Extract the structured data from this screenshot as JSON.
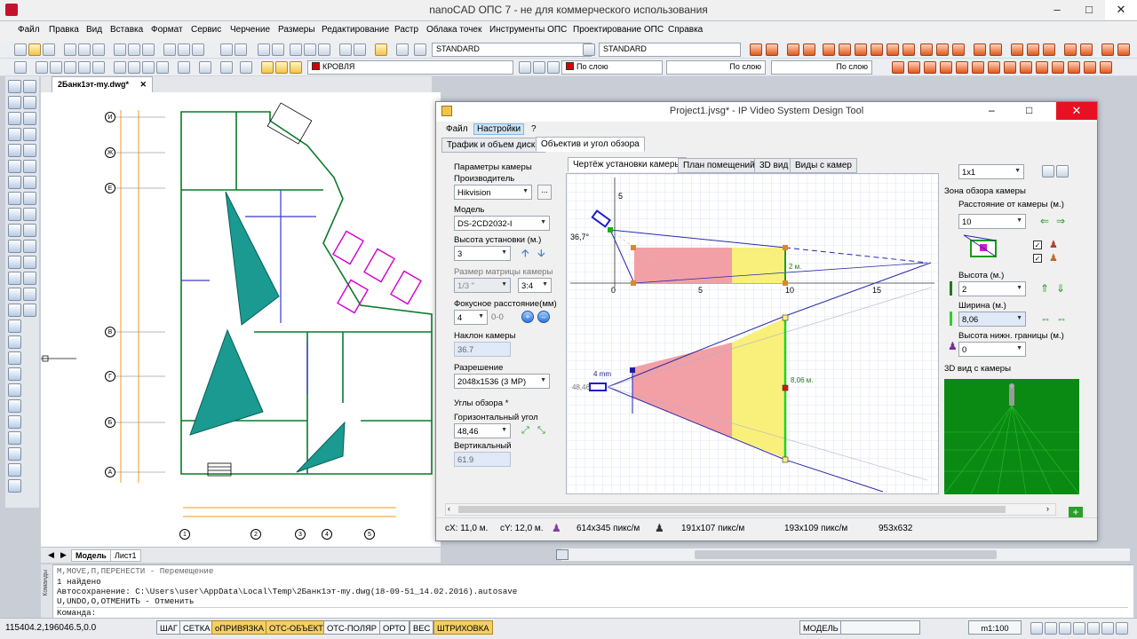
{
  "app": {
    "title": "nanoCAD ОПС 7 - не для коммерческого использования"
  },
  "menu": [
    "Файл",
    "Правка",
    "Вид",
    "Вставка",
    "Формат",
    "Сервис",
    "Черчение",
    "Размеры",
    "Редактирование",
    "Растр",
    "Облака точек",
    "Инструменты ОПС",
    "Проектирование ОПС",
    "Справка"
  ],
  "toolbar": {
    "text_style": "STANDARD",
    "dim_style": "STANDARD",
    "layer": "КРОВЛЯ",
    "color": "По слою",
    "linetype": "По слою",
    "lineweight": "По слою"
  },
  "document": {
    "tab_label": "2Банк1эт-my.dwg*"
  },
  "drawing": {
    "row_axes": [
      "И",
      "Ж",
      "Е",
      "В",
      "Г",
      "Б",
      "А"
    ],
    "col_axes": [
      "1",
      "2",
      "3",
      "4",
      "5"
    ]
  },
  "model_tabs": [
    "Модель",
    "Лист1"
  ],
  "console": {
    "lines": [
      "M,MOVE,П,ПЕРЕНЕСТИ - Перемещение",
      "1 найдено",
      "Автосохранение: C:\\Users\\user\\AppData\\Local\\Temp\\2Банк1эт-my.dwg(18-09-51_14.02.2016).autosave",
      "U,UNDO,О,ОТМЕНИТЬ - Отменить",
      "Команда:"
    ],
    "side_label": "Команды"
  },
  "statusbar": {
    "coords": "115404.2,196046.5,0.0",
    "toggles": [
      {
        "label": "ШАГ",
        "on": false
      },
      {
        "label": "СЕТКА",
        "on": false
      },
      {
        "label": "оПРИВЯЗКА",
        "on": true
      },
      {
        "label": "ОТС-ОБЪЕКТ",
        "on": true
      },
      {
        "label": "ОТС-ПОЛЯР",
        "on": false
      },
      {
        "label": "ОРТО",
        "on": false
      },
      {
        "label": "ВЕС",
        "on": false
      },
      {
        "label": "ШТРИХОВКА",
        "on": true
      }
    ],
    "space": "МОДЕЛЬ",
    "scale": "m1:100"
  },
  "dialog": {
    "title": "Project1.jvsg* - IP Video System Design Tool",
    "menu": [
      "Файл",
      "Настройки",
      "?"
    ],
    "tabs": [
      "Трафик и объем диска",
      "Объектив и угол обзора"
    ],
    "view_tabs": [
      "Чертёж установки камеры",
      "План помещений",
      "3D вид",
      "Виды с камер"
    ],
    "camera": {
      "section_title": "Параметры камеры",
      "manufacturer_label": "Производитель",
      "manufacturer": "Hikvision",
      "browse_button": "...",
      "model_label": "Модель",
      "model": "DS-2CD2032-I",
      "height_label": "Высота установки (м.)",
      "height": "3",
      "sensor_label": "Размер матрицы камеры",
      "sensor": "1/3 \"",
      "aspect": "3:4",
      "focal_label": "Фокусное расстояние(мм)",
      "focal": "4",
      "focal_range": "0-0",
      "tilt_label": "Наклон камеры",
      "tilt": "36.7",
      "resolution_label": "Разрешение",
      "resolution": "2048x1536 (3 MP)",
      "angles_title": "Углы обзора *",
      "hangle_label": "Горизонтальный угол",
      "hangle": "48,46",
      "vangle_label": "Вертикальный",
      "vangle": "61.9"
    },
    "drawing": {
      "side_angle": "36,7°",
      "y_tick": "5",
      "x_ticks": [
        "0",
        "5",
        "10",
        "15"
      ],
      "side_dim": "2 м.",
      "top_dim": "8,06 м.",
      "lens": "4 mm",
      "top_angle": "48,46"
    },
    "right": {
      "layout": "1x1",
      "zone_title": "Зона обзора камеры",
      "distance_label": "Расстояние от камеры (м.)",
      "distance": "10",
      "height_label": "Высота (м.)",
      "height": "2",
      "width_label": "Ширина (м.)",
      "width": "8,06",
      "lower_label": "Высота нижн. границы (м.)",
      "lower": "0",
      "view3d_label": "3D вид с камеры"
    },
    "status": {
      "cx": "cX: 11,0 м.",
      "cy": "cY: 12,0 м.",
      "res1": "614x345 пикс/м",
      "res2": "191x107 пикс/м",
      "res3": "193x109 пикс/м",
      "res4": "953x632"
    }
  }
}
